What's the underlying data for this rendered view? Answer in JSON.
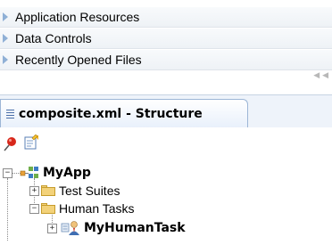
{
  "accordion": {
    "items": [
      {
        "label": "Application Resources"
      },
      {
        "label": "Data Controls"
      },
      {
        "label": "Recently Opened Files"
      }
    ]
  },
  "structure_panel": {
    "tab_title": "composite.xml - Structure"
  },
  "toolbar": {
    "icons": [
      "pin-icon",
      "edit-properties-icon"
    ]
  },
  "tree": {
    "root": {
      "label": "MyApp",
      "expander": "−"
    },
    "children": [
      {
        "label": "Test Suites",
        "expander": "+"
      },
      {
        "label": "Human Tasks",
        "expander": "−"
      }
    ],
    "grandchild": {
      "label": "MyHumanTask",
      "expander": "+"
    }
  },
  "colors": {
    "accent": "#8fb0d6",
    "tab_border": "#9db6d6",
    "folder": "#f3d27a"
  }
}
